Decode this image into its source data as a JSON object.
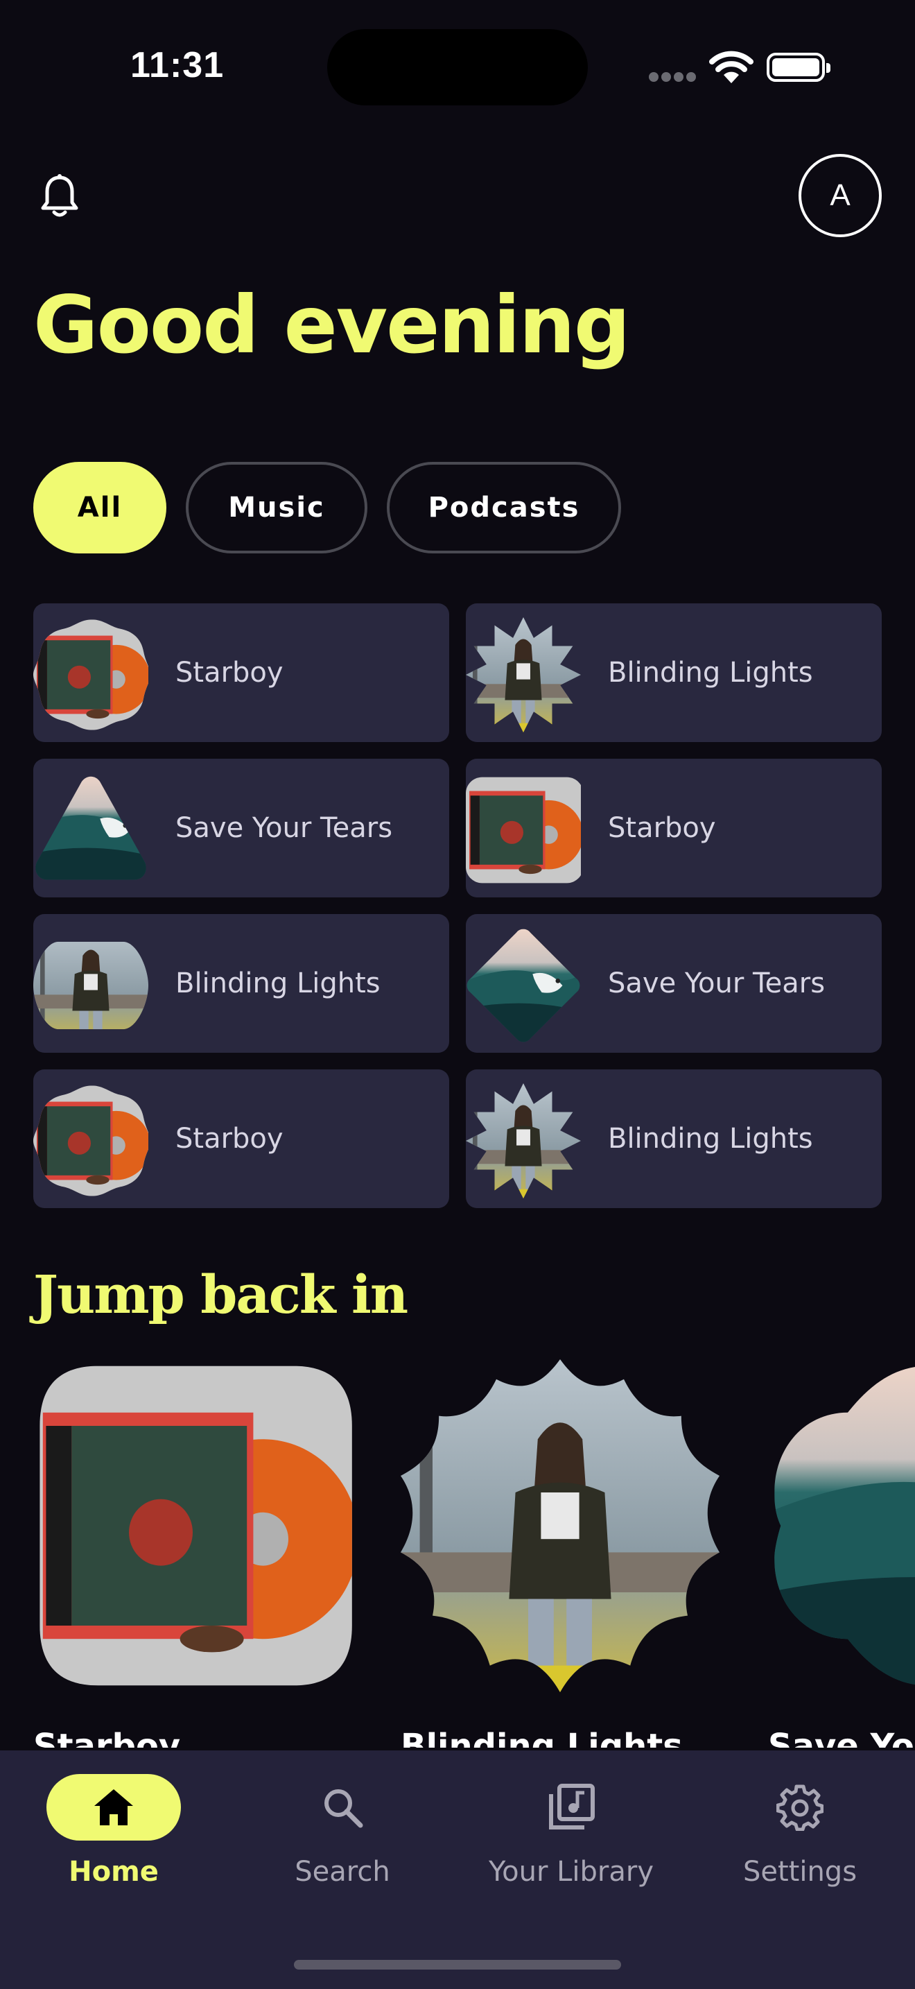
{
  "status_bar": {
    "time": "11:31"
  },
  "header": {
    "avatar_initial": "A",
    "greeting": "Good evening"
  },
  "filters": [
    {
      "label": "All",
      "active": true
    },
    {
      "label": "Music",
      "active": false
    },
    {
      "label": "Podcasts",
      "active": false
    }
  ],
  "quick_picks": [
    {
      "label": "Starboy",
      "art": "vinyl",
      "shape": "cookie"
    },
    {
      "label": "Blinding Lights",
      "art": "person",
      "shape": "star"
    },
    {
      "label": "Save Your Tears",
      "art": "wave",
      "shape": "triangle"
    },
    {
      "label": "Starboy",
      "art": "vinyl",
      "shape": "square"
    },
    {
      "label": "Blinding Lights",
      "art": "person",
      "shape": "pill"
    },
    {
      "label": "Save Your Tears",
      "art": "wave",
      "shape": "diamond"
    },
    {
      "label": "Starboy",
      "art": "vinyl",
      "shape": "cookie"
    },
    {
      "label": "Blinding Lights",
      "art": "person",
      "shape": "star"
    }
  ],
  "jump_back_in": {
    "title": "Jump back in",
    "items": [
      {
        "label": "Starboy",
        "art": "vinyl",
        "shape": "rounded-square"
      },
      {
        "label": "Blinding Lights",
        "art": "person",
        "shape": "wavy-circle"
      },
      {
        "label": "Save Your Tears",
        "art": "wave",
        "shape": "cloud"
      }
    ]
  },
  "bottom_nav": [
    {
      "label": "Home",
      "icon": "home-icon",
      "active": true
    },
    {
      "label": "Search",
      "icon": "search-icon",
      "active": false
    },
    {
      "label": "Your Library",
      "icon": "library-icon",
      "active": false
    },
    {
      "label": "Settings",
      "icon": "settings-icon",
      "active": false
    }
  ],
  "colors": {
    "accent": "#f0fa72",
    "background": "#0c0a12",
    "tile": "#29283f",
    "nav": "#24223a"
  }
}
